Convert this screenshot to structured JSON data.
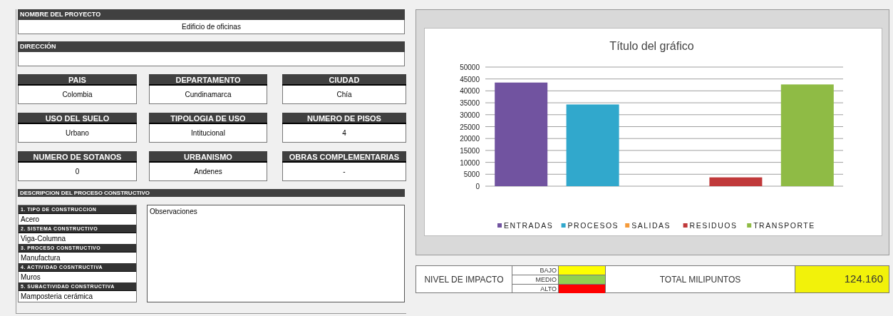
{
  "project": {
    "name_label": "NOMBRE DEL PROYECTO",
    "name_value": "Edificio de oficinas",
    "address_label": "DIRECCIÓN"
  },
  "fields": [
    {
      "label": "PAIS",
      "value": "Colombia"
    },
    {
      "label": "DEPARTAMENTO",
      "value": "Cundinamarca"
    },
    {
      "label": "CIUDAD",
      "value": "Chía"
    },
    {
      "label": "USO DEL SUELO",
      "value": "Urbano"
    },
    {
      "label": "TIPOLOGIA DE USO",
      "value": "Intitucional"
    },
    {
      "label": "NUMERO DE PISOS",
      "value": "4"
    },
    {
      "label": "NUMERO DE SOTANOS",
      "value": "0"
    },
    {
      "label": "URBANISMO",
      "value": "Andenes"
    },
    {
      "label": "OBRAS COMPLEMENTARIAS",
      "value": "-"
    }
  ],
  "process": {
    "title": "DESCRIPCION DEL PROCESO CONSTRUCTIVO",
    "steps": [
      {
        "label": "1. TIPO DE CONSTRUCCION",
        "value": "Acero"
      },
      {
        "label": "2. SISTEMA CONSTRUCTIVO",
        "value": "Viga-Columna"
      },
      {
        "label": "3. PROCESO CONSTRUCTIVO",
        "value": "Manufactura"
      },
      {
        "label": "4. ACTIVIDAD COSNTRUCTIVA",
        "value": "Muros"
      },
      {
        "label": "5. SUBACTIVIDAD CONSTRUCTIVA",
        "value": "Mamposteria cerámica"
      }
    ],
    "observations": "Observaciones"
  },
  "chart": {
    "chart_data": {
      "type": "bar",
      "title": "Título del gráfico",
      "grid": true,
      "legend": "bottom",
      "series": [
        {
          "name": "ENTRADAS",
          "color": "#7153a0",
          "values": [
            43500,
            null,
            null,
            null,
            null
          ]
        },
        {
          "name": "PROCESOS",
          "color": "#31a8cc",
          "values": [
            null,
            34300,
            null,
            null,
            null
          ]
        },
        {
          "name": "SALIDAS",
          "color": "#f59b3a",
          "values": [
            null,
            null,
            0,
            null,
            null
          ]
        },
        {
          "name": "RESIDUOS",
          "color": "#c0393a",
          "values": [
            null,
            null,
            null,
            3700,
            null
          ]
        },
        {
          "name": "TRANSPORTE",
          "color": "#8fbb45",
          "values": [
            null,
            null,
            null,
            null,
            42700
          ]
        }
      ],
      "ylim": [
        0,
        50000
      ],
      "yticks": [
        0,
        5000,
        10000,
        15000,
        20000,
        25000,
        30000,
        35000,
        40000,
        45000,
        50000
      ]
    }
  },
  "impact": {
    "label": "NIVEL DE IMPACTO",
    "levels": [
      {
        "label": "BAJO",
        "color": "#ffff00"
      },
      {
        "label": "MEDIO",
        "color": "#92d050"
      },
      {
        "label": "ALTO",
        "color": "#ff0000"
      }
    ],
    "total_label": "TOTAL MILIPUNTOS",
    "total_value": "124.160"
  }
}
